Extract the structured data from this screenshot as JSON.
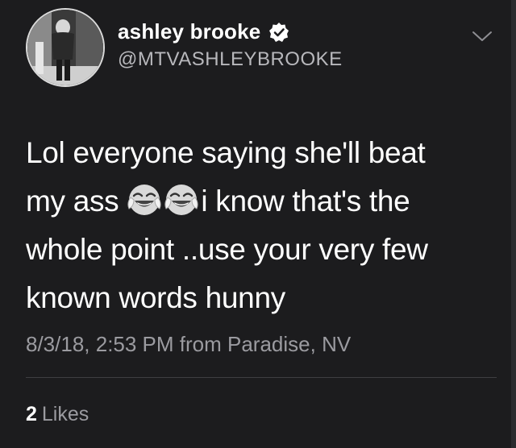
{
  "author": {
    "display_name": "ashley brooke",
    "handle": "@MTVASHLEYBROOKE",
    "verified_icon": "verified-badge-icon",
    "avatar_icon": "avatar"
  },
  "menu": {
    "icon": "chevron-down-icon"
  },
  "tweet": {
    "line1": "Lol everyone saying she'll beat",
    "line2_before": "my ass",
    "line2_emoji": "😂😂",
    "line2_after": "i know that's the",
    "line3": "whole point ..use your very few",
    "line4": "known words hunny",
    "timestamp": "8/3/18, 2:53 PM from Paradise, NV"
  },
  "stats": {
    "likes_count": "2",
    "likes_label": "Likes"
  },
  "colors": {
    "background": "#1c1c1e",
    "text_primary": "#ffffff",
    "text_secondary": "#9b9ba0",
    "divider": "#3e3e42"
  }
}
